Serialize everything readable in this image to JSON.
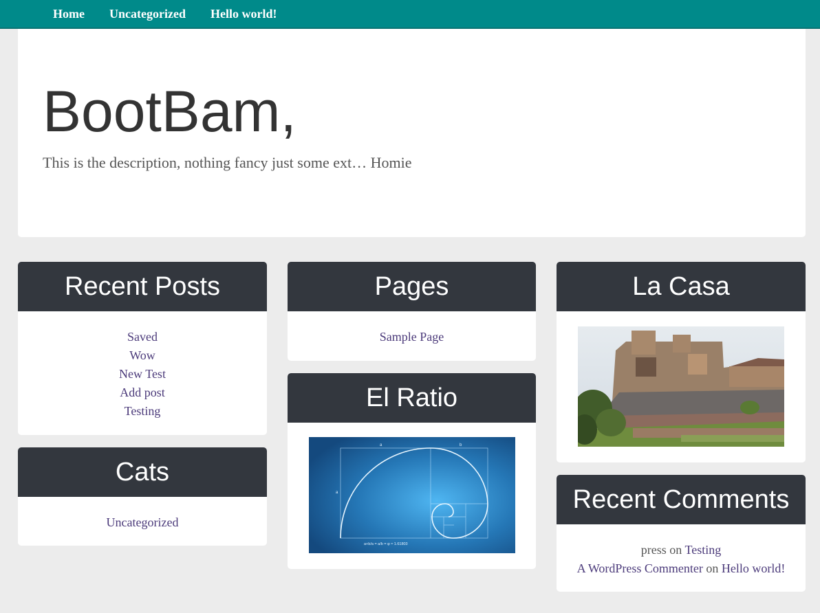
{
  "nav": {
    "items": [
      "Home",
      "Uncategorized",
      "Hello world!"
    ]
  },
  "hero": {
    "title": "BootBam,",
    "description": "This is the description, nothing fancy just some ext… Homie"
  },
  "widgets": {
    "recent_posts": {
      "title": "Recent Posts",
      "items": [
        "Saved",
        "Wow",
        "New Test",
        "Add post",
        "Testing"
      ]
    },
    "cats": {
      "title": "Cats",
      "items": [
        "Uncategorized"
      ]
    },
    "pages": {
      "title": "Pages",
      "items": [
        "Sample Page"
      ]
    },
    "el_ratio": {
      "title": "El Ratio",
      "image_labels": {
        "a": "a",
        "b": "b",
        "side": "a",
        "formula": "a+b/a = a/b = φ ≈ 1.61803"
      }
    },
    "la_casa": {
      "title": "La Casa"
    },
    "recent_comments": {
      "title": "Recent Comments",
      "comments": [
        {
          "author": "press",
          "connector": "on",
          "post": "Testing"
        },
        {
          "author": "A WordPress Commenter",
          "connector": "on",
          "post": "Hello world!"
        }
      ]
    }
  },
  "colors": {
    "nav_bg": "#008a8a",
    "widget_header_bg": "#33373e",
    "link": "#4b3a7a",
    "page_bg": "#ececec"
  }
}
